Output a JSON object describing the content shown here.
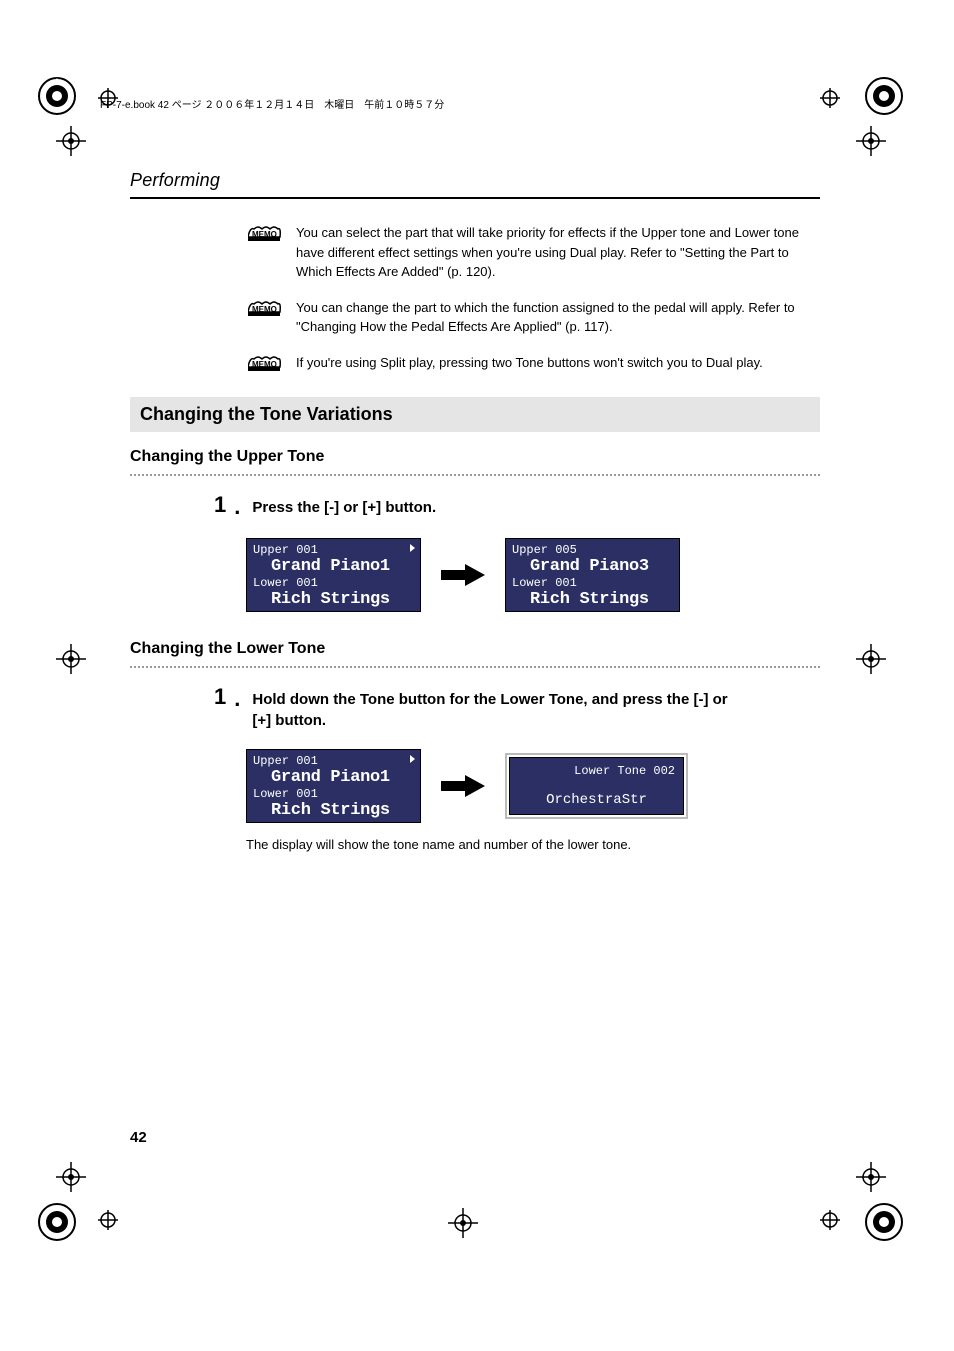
{
  "header": {
    "running_text": "FP-7-e.book 42 ページ ２００６年１２月１４日　木曜日　午前１０時５７分"
  },
  "section_title": "Performing",
  "memos": [
    {
      "text": "You can select the part that will take priority for effects if the Upper tone and Lower tone have different effect settings when you're using Dual play. Refer to \"Setting the Part to Which Effects Are Added\" (p. 120)."
    },
    {
      "text": "You can change the part to which the function assigned to the pedal will apply. Refer to \"Changing How the Pedal Effects Are Applied\" (p. 117)."
    },
    {
      "text": "If you're using Split play, pressing two Tone buttons won't switch you to Dual play."
    }
  ],
  "gray_heading": "Changing the Tone Variations",
  "upper": {
    "heading": "Changing the Upper Tone",
    "step_num": "1",
    "step_dot": ".",
    "step_text": "Press the [-] or [+] button.",
    "lcd_left": {
      "l1": "Upper 001",
      "l2": "Grand Piano1",
      "l3": "Lower 001",
      "l4": "Rich Strings"
    },
    "lcd_right": {
      "l1": "Upper 005",
      "l2": "Grand Piano3",
      "l3": "Lower 001",
      "l4": "Rich Strings"
    }
  },
  "lower": {
    "heading": "Changing the Lower Tone",
    "step_num": "1",
    "step_dot": ".",
    "step_text": "Hold down the Tone button for the Lower Tone, and press the [-] or [+] button.",
    "lcd_left": {
      "l1": "Upper 001",
      "l2": "Grand Piano1",
      "l3": "Lower 001",
      "l4": "Rich Strings"
    },
    "lcd_right": {
      "t1": "Lower Tone 002",
      "t2": "OrchestraStr"
    },
    "caption": "The display will show the tone name and number of the lower tone."
  },
  "page_number": "42",
  "icons": {
    "memo_label": "MEMO"
  }
}
